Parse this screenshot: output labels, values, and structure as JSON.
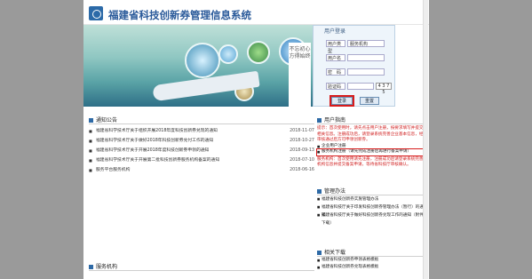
{
  "header": {
    "title": "福建省科技创新券管理信息系统"
  },
  "banner": {
    "sign_text": "不忘初心方得始终"
  },
  "login": {
    "title": "用户登录",
    "user_type_label": "用户类型",
    "user_type_value": "服务机构",
    "username_label": "用户名",
    "password_label": "密　码",
    "captcha_label": "验证码",
    "captcha_image_text": "4 3 7 5",
    "login_button": "登录",
    "reset_button": "重置"
  },
  "notice": {
    "heading": "通知公告",
    "items": [
      {
        "text": "福建省科学技术厅关于组织开展2018年度科技创新券兑现的通知",
        "date": "2018-11-07"
      },
      {
        "text": "福建省科学技术厅关于做好2018年科技创新券兑付工作的通知",
        "date": "2018-10-27"
      },
      {
        "text": "福建省科学技术厅关于开展2018年度科技创新券申领的通知",
        "date": "2018-09-13"
      },
      {
        "text": "福建省科学技术厅关于开展第二批科技创新券服务机构备案的通知",
        "date": "2018-07-10"
      },
      {
        "text": "服务平台服务机构",
        "date": "2018-06-16"
      }
    ]
  },
  "stats": {
    "heading": "服务机构"
  },
  "guide": {
    "heading": "用户指南",
    "text": "提示：首次使用时，请先点击用户注册，按要求填写并提交相关信息。注册成功后，请登录系统完善企业基本信息，经审核通过后方可申领创新券。",
    "items": [
      {
        "text": "企业用户注册"
      },
      {
        "text": "服务机构注册（请先完成注册后再进行备案申请）"
      }
    ],
    "red_note": "服务机构：首次使用请先注册，注册成功后请登录系统完善机构信息并提交备案申请，等待省科技厅审核确认。"
  },
  "mgmt": {
    "heading": "管理办法",
    "items": [
      {
        "text": "福建省科技创新券实施管理办法"
      },
      {
        "text": "福建省科技厅关于印发科技创新券管理办法（暂行）的通知"
      },
      {
        "text": "福建省科技厅关于做好科技创新券兑现工作的通知（附件下载）"
      }
    ]
  },
  "related": {
    "heading": "相关下载",
    "items": [
      {
        "text": "福建省科技创新券申领表格模板"
      },
      {
        "text": "福建省科技创新券兑现表格模板"
      }
    ]
  }
}
